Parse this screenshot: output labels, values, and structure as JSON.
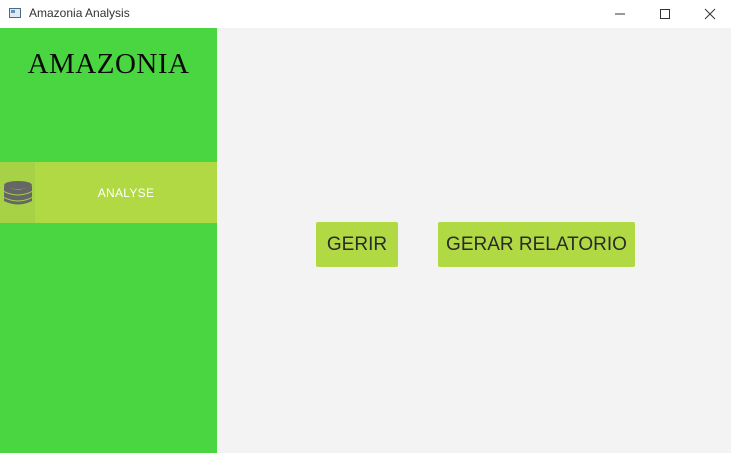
{
  "window": {
    "title": "Amazonia Analysis",
    "controls": [
      "minimize-icon",
      "maximize-icon",
      "close-icon"
    ]
  },
  "sidebar": {
    "brand": "AMAZONIA",
    "items": [
      {
        "label": "ANALYSE",
        "icon": "database-icon"
      }
    ],
    "colors": {
      "background": "#4ad641",
      "item_background": "#b0d944"
    }
  },
  "main": {
    "buttons": {
      "gerir": "GERIR",
      "gerar_relatorio": "GERAR RELATORIO"
    },
    "colors": {
      "background": "#f3f3f3",
      "button_background": "#b0d944"
    }
  }
}
